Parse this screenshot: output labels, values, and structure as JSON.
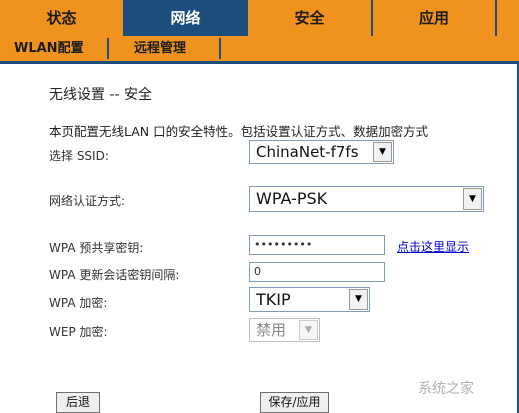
{
  "nav": {
    "tabs": [
      "状态",
      "网络",
      "安全",
      "应用",
      ""
    ],
    "active_index": 1,
    "sub_tabs": [
      "WLAN配置",
      "远程管理"
    ]
  },
  "page": {
    "title": "无线设置 -- 安全",
    "description": "本页配置无线LAN 口的安全特性。包括设置认证方式、数据加密方式"
  },
  "form": {
    "ssid": {
      "label": "选择 SSID:",
      "value": "ChinaNet-f7fs"
    },
    "auth": {
      "label": "网络认证方式:",
      "value": "WPA-PSK"
    },
    "psk": {
      "label": "WPA 预共享密钥:",
      "value": "•••••••••",
      "show_link": "点击这里显示"
    },
    "rekey": {
      "label": "WPA 更新会话密钥间隔:",
      "value": "0"
    },
    "wpa_enc": {
      "label": "WPA 加密:",
      "value": "TKIP"
    },
    "wep_enc": {
      "label": "WEP 加密:",
      "value": "禁用"
    }
  },
  "buttons": {
    "back": "后退",
    "save": "保存/应用"
  },
  "watermark": "系统之家",
  "colors": {
    "nav_blue": "#1c4d7d",
    "nav_orange": "#f0931e",
    "link": "#0000cc"
  }
}
